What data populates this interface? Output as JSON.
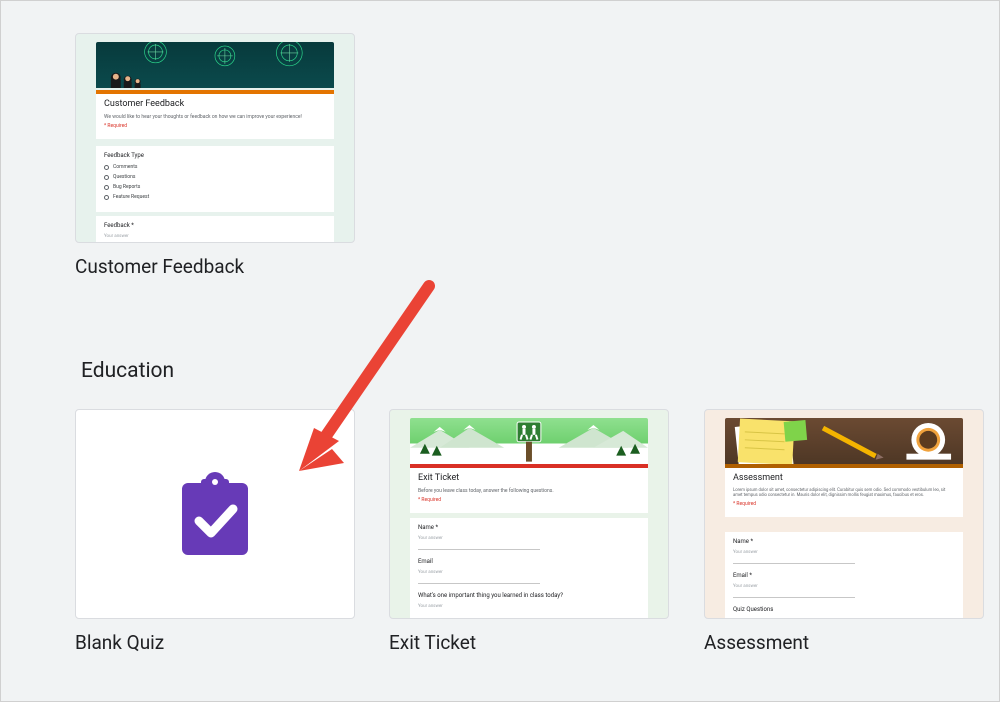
{
  "top_templates": [
    {
      "name": "Customer Feedback",
      "preview": {
        "title": "Customer Feedback",
        "subtitle": "We would like to hear your thoughts or feedback on how we can improve your experience!",
        "required_label": "* Required",
        "q1_label": "Feedback Type",
        "q1_options": [
          "Comments",
          "Questions",
          "Bug Reports",
          "Feature Request"
        ],
        "q2_label": "Feedback *",
        "q2_placeholder": "Your answer"
      }
    }
  ],
  "section_header": "Education",
  "education_templates": [
    {
      "name": "Blank Quiz",
      "icon": "clipboard-check-icon",
      "icon_color": "#673ab7"
    },
    {
      "name": "Exit Ticket",
      "preview": {
        "title": "Exit Ticket",
        "subtitle": "Before you leave class today, answer the following questions.",
        "required_label": "* Required",
        "field1_label": "Name *",
        "field1_placeholder": "Your answer",
        "field2_label": "Email",
        "field2_placeholder": "Your answer",
        "q_label": "What's one important thing you learned in class today?",
        "q_placeholder": "Your answer"
      }
    },
    {
      "name": "Assessment",
      "preview": {
        "title": "Assessment",
        "subtitle": "Lorem ipsum dolor sit amet, consectetur adipiscing elit. Curabitur quis sem odio. Sed commodo vestibulum leo, sit amet tempus odio consectetur in. Mauris dolor elit, dignissim mollis feugiat maximus, faucibus et eros.",
        "required_label": "* Required",
        "field1_label": "Name *",
        "field1_placeholder": "Your answer",
        "field2_label": "Email *",
        "field2_placeholder": "Your answer",
        "q_label": "Quiz Questions"
      }
    }
  ],
  "annotation": {
    "type": "arrow",
    "color": "#ea4335",
    "target": "Blank Quiz"
  }
}
